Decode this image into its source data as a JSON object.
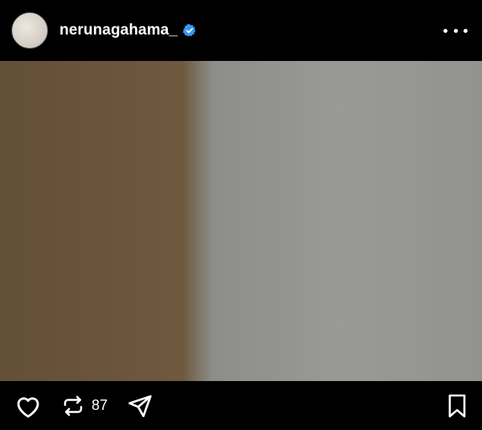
{
  "header": {
    "username": "nerunagahama_",
    "verified": true,
    "more_icon": "more-horizontal-icon"
  },
  "post": {
    "repost_count": "87"
  },
  "colors": {
    "background": "#000000",
    "text": "#ffffff",
    "verified_badge": "#3797f0"
  }
}
